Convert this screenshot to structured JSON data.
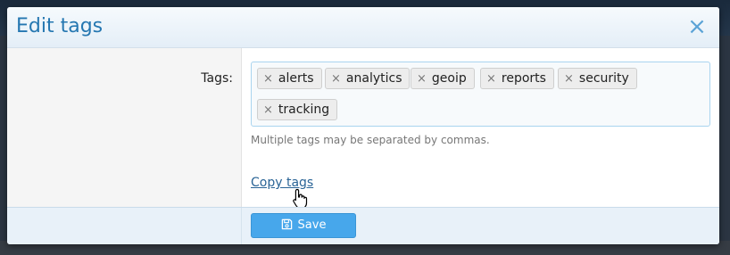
{
  "dialog": {
    "title": "Edit tags",
    "close_glyph": "×",
    "close_icon": "close-icon"
  },
  "form": {
    "tags_label": "Tags:",
    "tags": [
      {
        "label": "alerts"
      },
      {
        "label": "analytics"
      },
      {
        "label": "geoip"
      },
      {
        "label": "reports"
      },
      {
        "label": "security"
      },
      {
        "label": "tracking"
      }
    ],
    "remove_glyph": "×",
    "hint": "Multiple tags may be separated by commas.",
    "copy_link": "Copy tags"
  },
  "footer": {
    "save_label": "Save",
    "save_icon": "floppy-disk-icon"
  },
  "colors": {
    "title": "#2577b1",
    "button": "#47a7eb",
    "link": "#2a6496"
  }
}
